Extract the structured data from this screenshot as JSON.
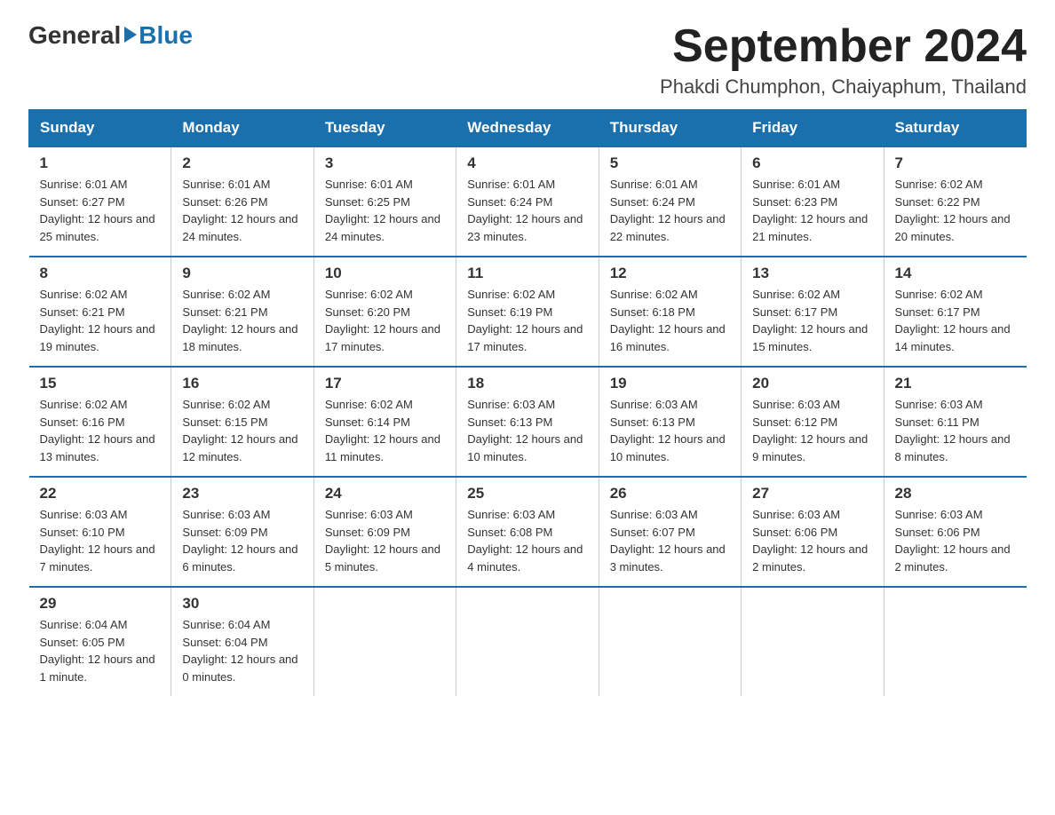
{
  "logo": {
    "general": "General",
    "blue": "Blue",
    "arrow": true
  },
  "header": {
    "month_title": "September 2024",
    "location": "Phakdi Chumphon, Chaiyaphum, Thailand"
  },
  "days_of_week": [
    "Sunday",
    "Monday",
    "Tuesday",
    "Wednesday",
    "Thursday",
    "Friday",
    "Saturday"
  ],
  "weeks": [
    [
      {
        "day": "1",
        "sunrise": "6:01 AM",
        "sunset": "6:27 PM",
        "daylight": "12 hours and 25 minutes."
      },
      {
        "day": "2",
        "sunrise": "6:01 AM",
        "sunset": "6:26 PM",
        "daylight": "12 hours and 24 minutes."
      },
      {
        "day": "3",
        "sunrise": "6:01 AM",
        "sunset": "6:25 PM",
        "daylight": "12 hours and 24 minutes."
      },
      {
        "day": "4",
        "sunrise": "6:01 AM",
        "sunset": "6:24 PM",
        "daylight": "12 hours and 23 minutes."
      },
      {
        "day": "5",
        "sunrise": "6:01 AM",
        "sunset": "6:24 PM",
        "daylight": "12 hours and 22 minutes."
      },
      {
        "day": "6",
        "sunrise": "6:01 AM",
        "sunset": "6:23 PM",
        "daylight": "12 hours and 21 minutes."
      },
      {
        "day": "7",
        "sunrise": "6:02 AM",
        "sunset": "6:22 PM",
        "daylight": "12 hours and 20 minutes."
      }
    ],
    [
      {
        "day": "8",
        "sunrise": "6:02 AM",
        "sunset": "6:21 PM",
        "daylight": "12 hours and 19 minutes."
      },
      {
        "day": "9",
        "sunrise": "6:02 AM",
        "sunset": "6:21 PM",
        "daylight": "12 hours and 18 minutes."
      },
      {
        "day": "10",
        "sunrise": "6:02 AM",
        "sunset": "6:20 PM",
        "daylight": "12 hours and 17 minutes."
      },
      {
        "day": "11",
        "sunrise": "6:02 AM",
        "sunset": "6:19 PM",
        "daylight": "12 hours and 17 minutes."
      },
      {
        "day": "12",
        "sunrise": "6:02 AM",
        "sunset": "6:18 PM",
        "daylight": "12 hours and 16 minutes."
      },
      {
        "day": "13",
        "sunrise": "6:02 AM",
        "sunset": "6:17 PM",
        "daylight": "12 hours and 15 minutes."
      },
      {
        "day": "14",
        "sunrise": "6:02 AM",
        "sunset": "6:17 PM",
        "daylight": "12 hours and 14 minutes."
      }
    ],
    [
      {
        "day": "15",
        "sunrise": "6:02 AM",
        "sunset": "6:16 PM",
        "daylight": "12 hours and 13 minutes."
      },
      {
        "day": "16",
        "sunrise": "6:02 AM",
        "sunset": "6:15 PM",
        "daylight": "12 hours and 12 minutes."
      },
      {
        "day": "17",
        "sunrise": "6:02 AM",
        "sunset": "6:14 PM",
        "daylight": "12 hours and 11 minutes."
      },
      {
        "day": "18",
        "sunrise": "6:03 AM",
        "sunset": "6:13 PM",
        "daylight": "12 hours and 10 minutes."
      },
      {
        "day": "19",
        "sunrise": "6:03 AM",
        "sunset": "6:13 PM",
        "daylight": "12 hours and 10 minutes."
      },
      {
        "day": "20",
        "sunrise": "6:03 AM",
        "sunset": "6:12 PM",
        "daylight": "12 hours and 9 minutes."
      },
      {
        "day": "21",
        "sunrise": "6:03 AM",
        "sunset": "6:11 PM",
        "daylight": "12 hours and 8 minutes."
      }
    ],
    [
      {
        "day": "22",
        "sunrise": "6:03 AM",
        "sunset": "6:10 PM",
        "daylight": "12 hours and 7 minutes."
      },
      {
        "day": "23",
        "sunrise": "6:03 AM",
        "sunset": "6:09 PM",
        "daylight": "12 hours and 6 minutes."
      },
      {
        "day": "24",
        "sunrise": "6:03 AM",
        "sunset": "6:09 PM",
        "daylight": "12 hours and 5 minutes."
      },
      {
        "day": "25",
        "sunrise": "6:03 AM",
        "sunset": "6:08 PM",
        "daylight": "12 hours and 4 minutes."
      },
      {
        "day": "26",
        "sunrise": "6:03 AM",
        "sunset": "6:07 PM",
        "daylight": "12 hours and 3 minutes."
      },
      {
        "day": "27",
        "sunrise": "6:03 AM",
        "sunset": "6:06 PM",
        "daylight": "12 hours and 2 minutes."
      },
      {
        "day": "28",
        "sunrise": "6:03 AM",
        "sunset": "6:06 PM",
        "daylight": "12 hours and 2 minutes."
      }
    ],
    [
      {
        "day": "29",
        "sunrise": "6:04 AM",
        "sunset": "6:05 PM",
        "daylight": "12 hours and 1 minute."
      },
      {
        "day": "30",
        "sunrise": "6:04 AM",
        "sunset": "6:04 PM",
        "daylight": "12 hours and 0 minutes."
      },
      null,
      null,
      null,
      null,
      null
    ]
  ],
  "labels": {
    "sunrise_prefix": "Sunrise: ",
    "sunset_prefix": "Sunset: ",
    "daylight_prefix": "Daylight: "
  }
}
